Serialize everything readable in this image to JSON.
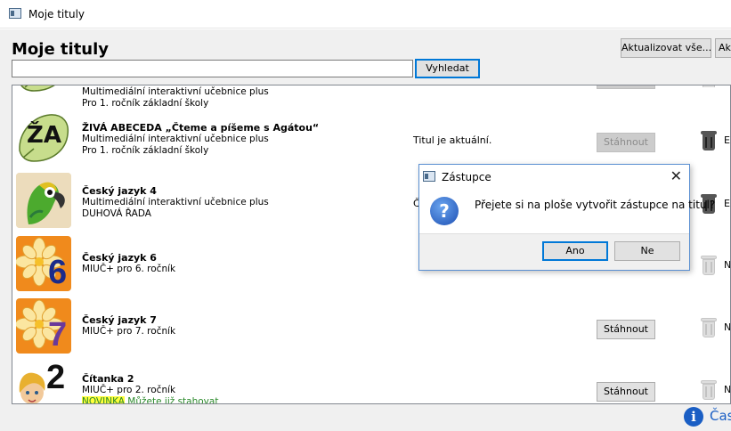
{
  "window": {
    "title": "Moje tituly"
  },
  "page": {
    "title": "Moje tituly",
    "update_all_label": "Aktualizovat vše...",
    "second_button_label": "Akt",
    "search_placeholder": "",
    "search_value": "",
    "search_button_label": "Vyhledat"
  },
  "titles": [
    {
      "name": "",
      "line1": "Multimediální interaktivní učebnice plus",
      "line2": "Pro 1. ročník základní školy",
      "status": "",
      "cover": "leaf-green"
    },
    {
      "name": "ŽIVÁ ABECEDA „Čteme a píšeme s Agátou“",
      "line1": "Multimediální interaktivní učebnice plus",
      "line2": "Pro 1. ročník základní školy",
      "status": "Titul je aktuální.",
      "button_label": "Stáhnout",
      "button_disabled": true,
      "trash_label": "E",
      "cover": "leaf-za",
      "cover_text": "ŽA"
    },
    {
      "name": "Český jazyk 4",
      "line1": "Multimediální interaktivní učebnice plus",
      "line2": "DUHOVÁ ŘADA",
      "status": "Č",
      "trash_label": "E",
      "cover": "parrot"
    },
    {
      "name": "Český jazyk 6",
      "line1": "MIUČ+ pro 6. ročník",
      "line2": "",
      "trash_label": "N",
      "cover": "flower-orange",
      "cover_text": "6"
    },
    {
      "name": "Český jazyk 7",
      "line1": "MIUČ+ pro 7. ročník",
      "line2": "",
      "button_label": "Stáhnout",
      "trash_label": "N",
      "cover": "flower-orange-purple",
      "cover_text": "7"
    },
    {
      "name": "Čítanka 2",
      "line1": "MIUČ+ pro 2. ročník",
      "badge": "NOVINKA",
      "line2": "Můžete již stahovat",
      "button_label": "Stáhnout",
      "trash_label": "N",
      "cover": "girl",
      "cover_text": "2"
    }
  ],
  "dialog": {
    "title": "Zástupce",
    "message": "Přejete si na ploše vytvořit zástupce na titul?",
    "yes_label": "Ano",
    "no_label": "Ne"
  },
  "footer": {
    "info_link_label": "Čas"
  },
  "icons": [
    "app-window-icon",
    "question-icon",
    "trash-icon",
    "info-icon",
    "close-icon"
  ],
  "colors": {
    "accent": "#0078d7",
    "info_blue": "#1a5ec4",
    "novinka_highlight": "#ffff3c",
    "novinka_text": "#2b8a2b"
  }
}
